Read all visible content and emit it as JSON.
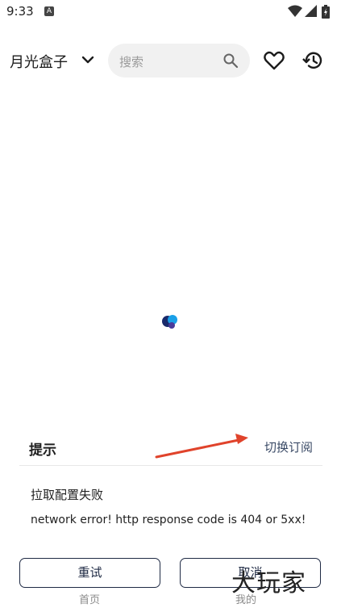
{
  "status_bar": {
    "time": "9:33",
    "notification_badge": "A"
  },
  "header": {
    "title": "月光盒子",
    "search_placeholder": "搜索"
  },
  "dialog": {
    "title": "提示",
    "switch_subscription_label": "切换订阅",
    "message": "拉取配置失败",
    "detail": "network error! http response code is 404 or 5xx!",
    "retry_label": "重试",
    "cancel_label": "取消",
    "behind_left": "首页",
    "behind_right": "我的"
  },
  "watermark": "大玩家",
  "colors": {
    "annotation_arrow": "#e0432b",
    "button_border": "#1f2a44",
    "loading_dark": "#1a2a6b",
    "loading_light": "#1aa0e8"
  }
}
